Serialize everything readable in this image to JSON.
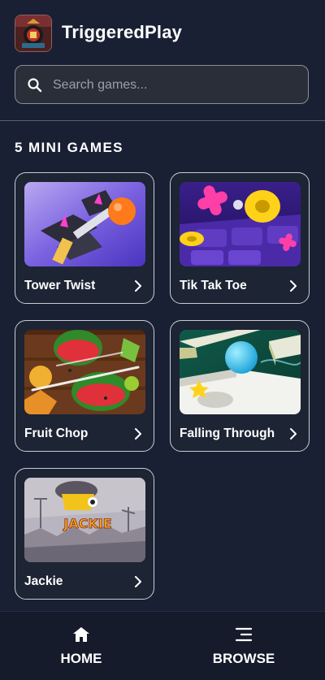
{
  "header": {
    "title": "TriggeredPlay",
    "logo_icon": "triggeredplay-logo-icon"
  },
  "search": {
    "placeholder": "Search games..."
  },
  "section": {
    "title": "5 MINI GAMES"
  },
  "games": [
    {
      "label": "Tower Twist",
      "thumb_icon": "tower-twist-thumbnail"
    },
    {
      "label": "Tik Tak Toe",
      "thumb_icon": "tik-tak-toe-thumbnail"
    },
    {
      "label": "Fruit Chop",
      "thumb_icon": "fruit-chop-thumbnail"
    },
    {
      "label": "Falling Through",
      "thumb_icon": "falling-through-thumbnail"
    },
    {
      "label": "Jackie",
      "thumb_icon": "jackie-thumbnail",
      "thumb_text": "JACKIE"
    }
  ],
  "nav": {
    "home_label": "HOME",
    "browse_label": "BROWSE",
    "home_icon": "home-icon",
    "browse_icon": "menu-icon"
  },
  "colors": {
    "background": "#1a2033",
    "card_border": "#c8ccd6",
    "nav_background": "#151b2b",
    "search_background": "#2a2e38"
  }
}
